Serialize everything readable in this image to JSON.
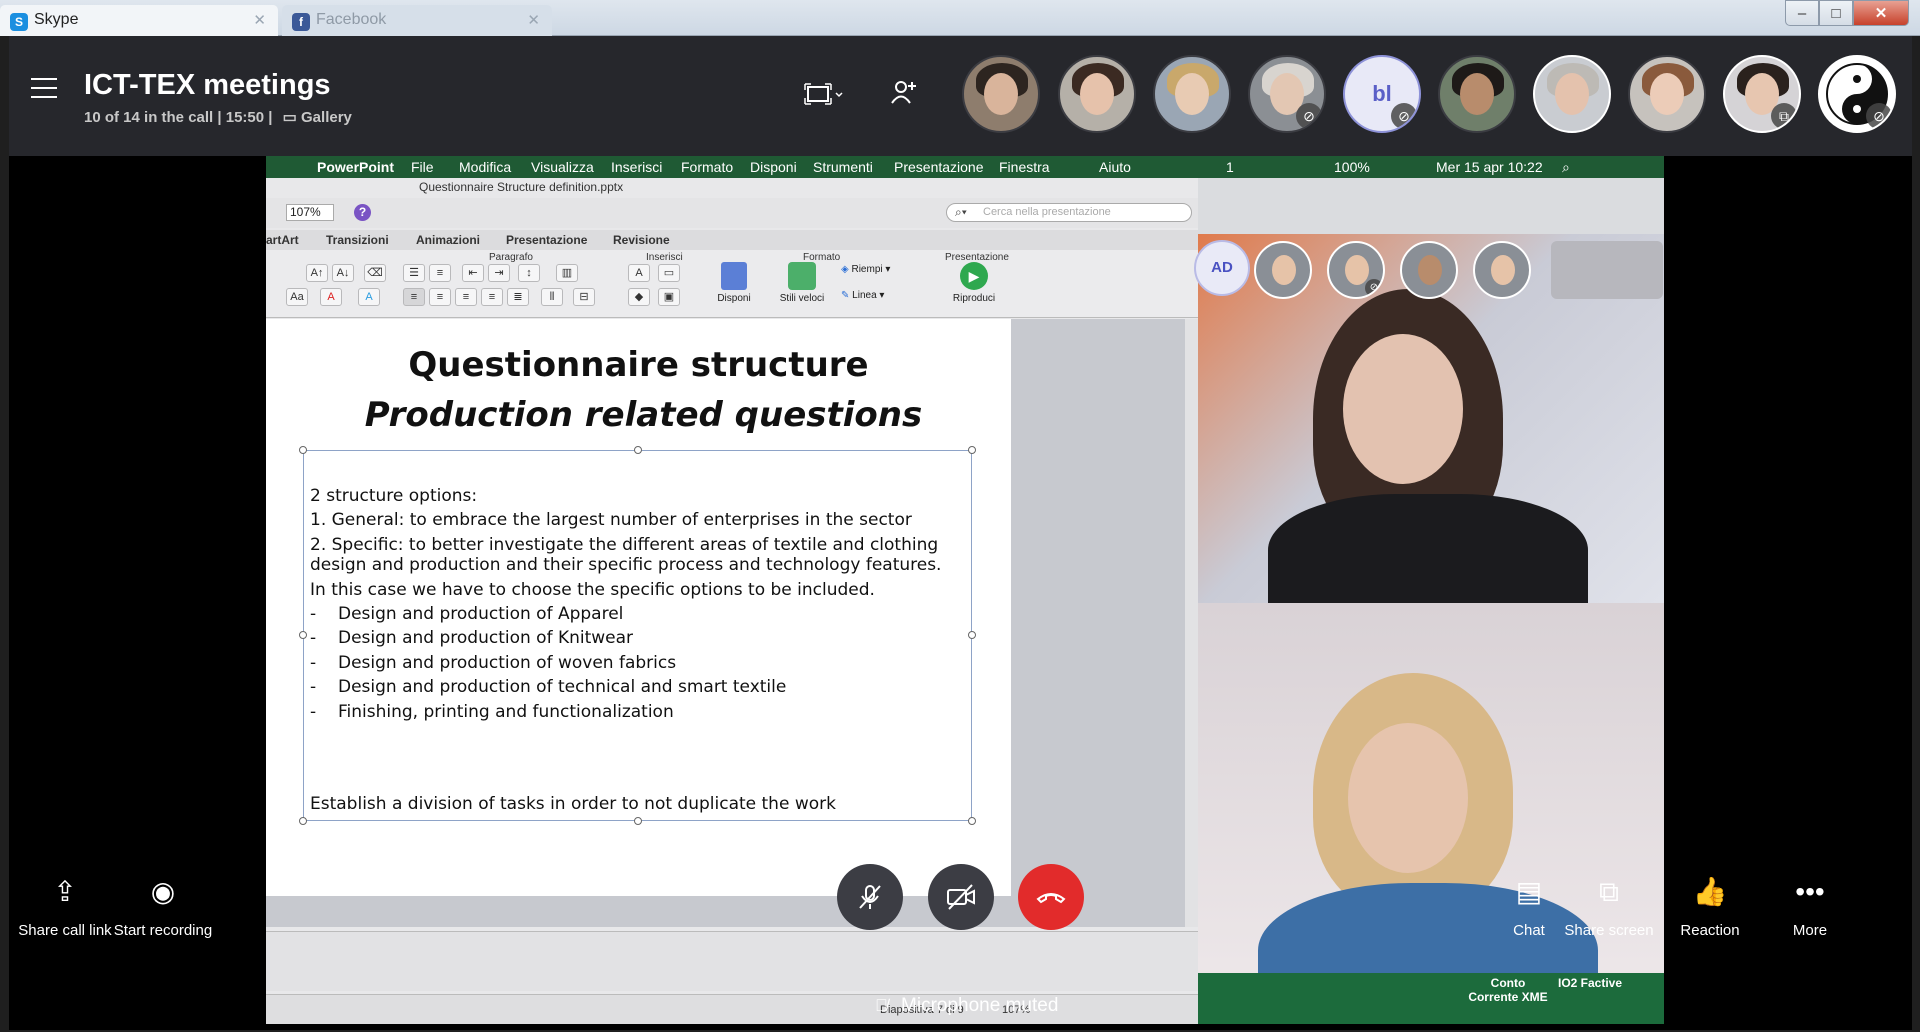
{
  "window": {
    "tabs": [
      {
        "label": "Skype",
        "icon": "skype-icon"
      },
      {
        "label": "Facebook",
        "icon": "facebook-icon"
      }
    ],
    "controls": {
      "minimize": "–",
      "maximize": "□",
      "close": "✕"
    }
  },
  "header": {
    "title": "ICT-TEX meetings",
    "subtitle": "10 of 14 in the call | 15:50 |",
    "view_label": "Gallery"
  },
  "participants": [
    {
      "name": "participant-1",
      "muted": false
    },
    {
      "name": "participant-2",
      "muted": false
    },
    {
      "name": "participant-3",
      "muted": false
    },
    {
      "name": "participant-4",
      "muted": true
    },
    {
      "name": "participant-bl",
      "initials": "bl",
      "muted": true
    },
    {
      "name": "participant-6",
      "muted": false
    },
    {
      "name": "participant-7",
      "muted": false
    },
    {
      "name": "participant-8",
      "muted": false
    },
    {
      "name": "participant-9",
      "muted": false
    },
    {
      "name": "participant-10",
      "muted": true
    }
  ],
  "mac_menu": {
    "app": "PowerPoint",
    "items": [
      "File",
      "Modifica",
      "Visualizza",
      "Inserisci",
      "Formato",
      "Disponi",
      "Strumenti",
      "Presentazione",
      "Finestra",
      "Aiuto"
    ],
    "status": {
      "indicator": "1",
      "battery": "100%",
      "datetime": "Mer 15 apr  10:22"
    }
  },
  "ppt": {
    "filename": "Questionnaire Structure definition.pptx",
    "zoom": "107%",
    "search_placeholder": "Cerca nella presentazione",
    "ribbon_tabs": [
      "artArt",
      "Transizioni",
      "Animazioni",
      "Presentazione",
      "Revisione"
    ],
    "ribbon_groups": {
      "paragrafo": "Paragrafo",
      "inserisci": "Inserisci",
      "formato": "Formato",
      "presentazione": "Presentazione"
    },
    "ribbon_buttons": {
      "disponi": "Disponi",
      "stili": "Stili veloci",
      "riempi": "Riempi",
      "linea": "Linea",
      "riproduci": "Riproduci"
    },
    "slide": {
      "title": "Questionnaire structure",
      "subtitle": "Production related questions",
      "lines": [
        "2 structure options:",
        "1. General: to embrace the largest number of enterprises in the sector",
        "2. Specific: to better investigate the different areas of textile and clothing design and production and their specific process and technology features.",
        "In this case we have to choose the specific options to be included."
      ],
      "bullets": [
        "Design and production of Apparel",
        "Design and production of Knitwear",
        "Design and production of woven fabrics",
        "Design and production of technical and smart textile",
        "Finishing, printing and functionalization"
      ],
      "footer": "Establish a division of tasks in order to not duplicate the work"
    },
    "status": {
      "slide": "Diapositiva 7 di 9",
      "zoom": "107%"
    }
  },
  "remote": {
    "mini_ad": "AD",
    "cam_labels": {
      "left": "Conto Corrente XME",
      "right": "IO2 Factive"
    }
  },
  "controls": {
    "share_link": "Share call link",
    "start_recording": "Start recording",
    "chat": "Chat",
    "share_screen": "Share screen",
    "reaction": "Reaction",
    "more": "More",
    "mic_status": "Microphone muted"
  },
  "colors": {
    "end_call": "#e22b2b",
    "header_bg": "#26272c",
    "accent": "#5a5fc7"
  }
}
